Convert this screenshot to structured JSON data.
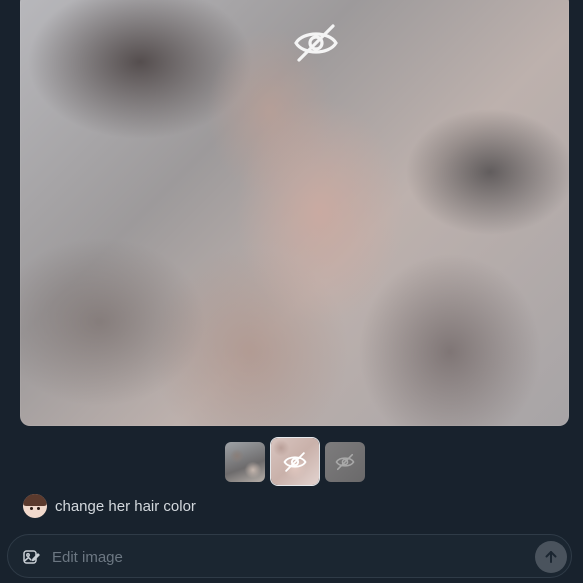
{
  "main_image": {
    "state": "hidden",
    "icon": "eye-off-icon"
  },
  "thumbnails": [
    {
      "name": "thumbnail-1",
      "state": "visible"
    },
    {
      "name": "thumbnail-2",
      "state": "hidden-selected",
      "icon": "eye-off-icon"
    },
    {
      "name": "thumbnail-3",
      "state": "hidden",
      "icon": "eye-off-icon"
    }
  ],
  "prompt": {
    "text": "change her hair color"
  },
  "input": {
    "placeholder": "Edit image",
    "value": "",
    "left_icon": "image-edit-icon",
    "send_icon": "arrow-up-icon"
  }
}
